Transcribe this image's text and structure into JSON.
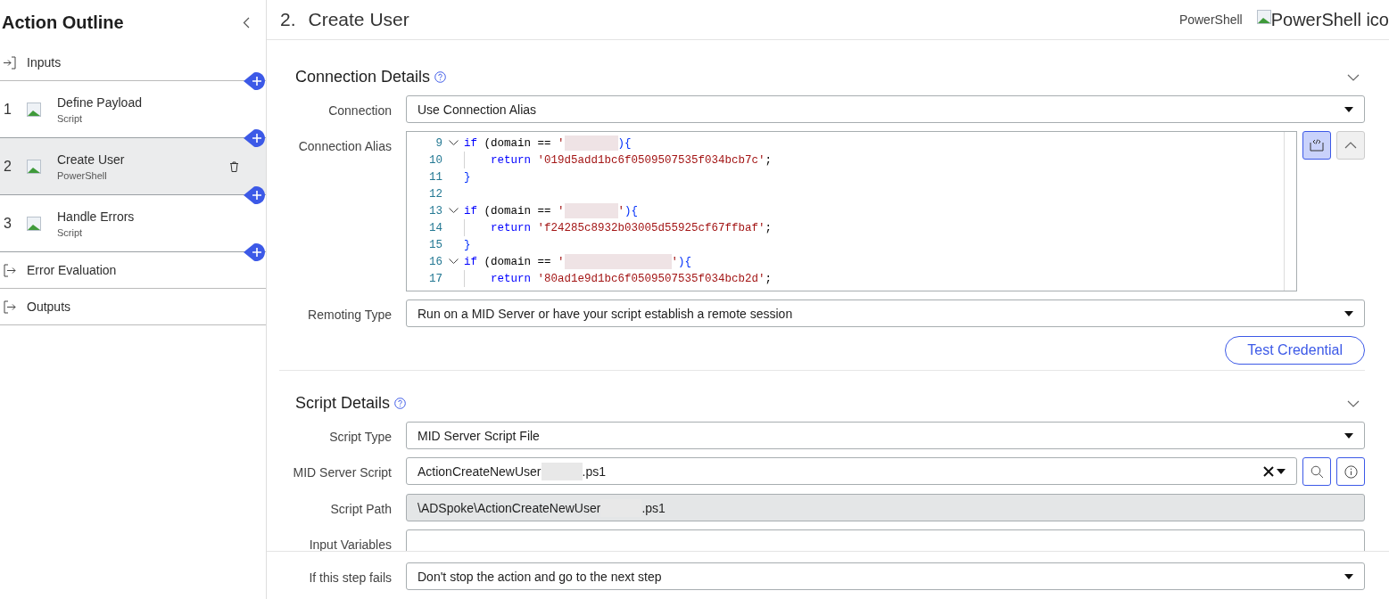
{
  "sidebar": {
    "title": "Action Outline",
    "items": [
      {
        "kind": "input",
        "label": "Inputs"
      },
      {
        "kind": "step",
        "number": "1",
        "label": "Define Payload",
        "type": "Script",
        "selected": false
      },
      {
        "kind": "step",
        "number": "2",
        "label": "Create User",
        "type": "PowerShell",
        "selected": true
      },
      {
        "kind": "step",
        "number": "3",
        "label": "Handle Errors",
        "type": "Script",
        "selected": false
      },
      {
        "kind": "output",
        "label": "Error Evaluation"
      },
      {
        "kind": "output",
        "label": "Outputs"
      }
    ]
  },
  "header": {
    "number": "2.",
    "title": "Create User",
    "type_label": "PowerShell",
    "icon_alt": "PowerShell ico"
  },
  "sections": [
    {
      "title": "Connection Details",
      "expanded": true,
      "rows": [
        {
          "kind": "select",
          "label": "Connection",
          "parts": [
            {
              "kind": "text",
              "text": "Use Connection Alias"
            }
          ]
        },
        {
          "kind": "code",
          "label": "Connection Alias",
          "lines": [
            {
              "number": "9",
              "fold": true,
              "indent": false,
              "tokens": [
                {
                  "kind": "keyword",
                  "text": "if"
                },
                {
                  "kind": "plain",
                  "text": " (domain == "
                },
                {
                  "kind": "string",
                  "text": "'"
                },
                {
                  "kind": "redacted"
                },
                {
                  "kind": "brace",
                  "text": "){"
                }
              ]
            },
            {
              "number": "10",
              "fold": false,
              "indent": true,
              "tokens": [
                {
                  "kind": "keyword",
                  "text": "return"
                },
                {
                  "kind": "string",
                  "text": " '019d5add1bc6f0509507535f034bcb7c'"
                },
                {
                  "kind": "plain",
                  "text": ";"
                }
              ]
            },
            {
              "number": "11",
              "fold": false,
              "indent": false,
              "tokens": [
                {
                  "kind": "brace",
                  "text": "}"
                }
              ]
            },
            {
              "number": "12",
              "fold": false,
              "indent": false
            },
            {
              "number": "13",
              "fold": true,
              "indent": false,
              "tokens": [
                {
                  "kind": "keyword",
                  "text": "if"
                },
                {
                  "kind": "plain",
                  "text": " (domain == "
                },
                {
                  "kind": "string",
                  "text": "'"
                },
                {
                  "kind": "redacted"
                },
                {
                  "kind": "string",
                  "text": "'"
                },
                {
                  "kind": "brace",
                  "text": "){"
                }
              ]
            },
            {
              "number": "14",
              "fold": false,
              "indent": true,
              "tokens": [
                {
                  "kind": "keyword",
                  "text": "return"
                },
                {
                  "kind": "string",
                  "text": " 'f24285c8932b03005d55925cf67ffbaf'"
                },
                {
                  "kind": "plain",
                  "text": ";"
                }
              ]
            },
            {
              "number": "15",
              "fold": false,
              "indent": false,
              "tokens": [
                {
                  "kind": "brace",
                  "text": "}"
                }
              ]
            },
            {
              "number": "16",
              "fold": true,
              "indent": false,
              "tokens": [
                {
                  "kind": "keyword",
                  "text": "if"
                },
                {
                  "kind": "plain",
                  "text": " (domain == "
                },
                {
                  "kind": "string",
                  "text": "'"
                },
                {
                  "kind": "redacted"
                },
                {
                  "kind": "redacted"
                },
                {
                  "kind": "string",
                  "text": "'"
                },
                {
                  "kind": "brace",
                  "text": "){"
                }
              ]
            },
            {
              "number": "17",
              "fold": false,
              "indent": true,
              "tokens": [
                {
                  "kind": "keyword",
                  "text": "return"
                },
                {
                  "kind": "string",
                  "text": " '80ad1e9d1bc6f0509507535f034bcb2d'"
                },
                {
                  "kind": "plain",
                  "text": ";"
                }
              ]
            }
          ]
        },
        {
          "kind": "select",
          "label": "Remoting Type",
          "parts": [
            {
              "kind": "text",
              "text": "Run on a MID Server or have your script establish a remote session"
            }
          ]
        }
      ],
      "button": "Test Credential"
    },
    {
      "title": "Script Details",
      "expanded": true,
      "rows": [
        {
          "kind": "select",
          "label": "Script Type",
          "parts": [
            {
              "kind": "text",
              "text": "MID Server Script File"
            }
          ]
        },
        {
          "kind": "lookup",
          "label": "MID Server Script",
          "parts": [
            {
              "kind": "text",
              "text": "ActionCreateNewUser"
            },
            {
              "kind": "redacted"
            },
            {
              "kind": "text",
              "text": ".ps1"
            }
          ]
        },
        {
          "kind": "readonly",
          "label": "Script Path",
          "parts": [
            {
              "kind": "text",
              "text": "\\ADSpoke\\ActionCreateNewUser"
            },
            {
              "kind": "redacted"
            },
            {
              "kind": "text",
              "text": ".ps1"
            }
          ]
        },
        {
          "kind": "input",
          "label": "Input Variables"
        }
      ]
    }
  ],
  "footer": {
    "label": "If this step fails",
    "parts": [
      {
        "kind": "text",
        "text": "Don't stop the action and go to the next step"
      }
    ]
  }
}
